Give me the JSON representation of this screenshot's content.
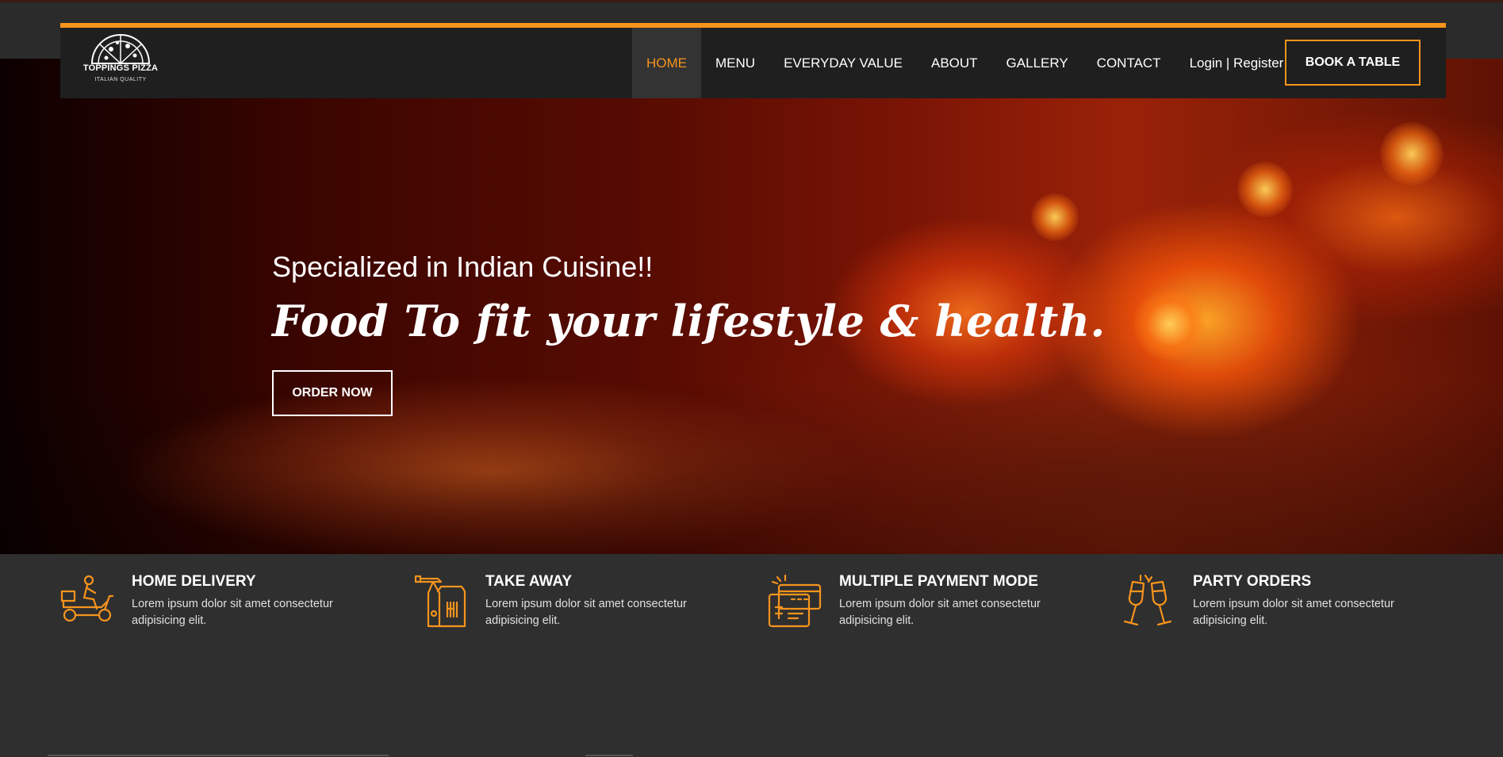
{
  "brand": {
    "name": "TOPPINGS PIZZA",
    "tagline": "ITALIAN QUALITY",
    "accent_color": "#f7941d"
  },
  "nav": {
    "items": [
      {
        "label": "HOME",
        "active": true
      },
      {
        "label": "MENU",
        "active": false
      },
      {
        "label": "EVERYDAY VALUE",
        "active": false
      },
      {
        "label": "ABOUT",
        "active": false
      },
      {
        "label": "GALLERY",
        "active": false
      },
      {
        "label": "CONTACT",
        "active": false
      }
    ],
    "login_label": "Login | Register",
    "book_label": "BOOK A TABLE"
  },
  "hero": {
    "subtitle": "Specialized in Indian Cuisine!!",
    "title": "Food To fit your lifestyle & health.",
    "cta_label": "ORDER NOW"
  },
  "features": [
    {
      "icon": "delivery-scooter-icon",
      "title": "HOME DELIVERY",
      "desc": "Lorem ipsum dolor sit amet consectetur adipisicing elit."
    },
    {
      "icon": "takeaway-bag-icon",
      "title": "TAKE AWAY",
      "desc": "Lorem ipsum dolor sit amet consectetur adipisicing elit."
    },
    {
      "icon": "payment-card-icon",
      "title": "MULTIPLE PAYMENT MODE",
      "desc": "Lorem ipsum dolor sit amet consectetur adipisicing elit."
    },
    {
      "icon": "party-glasses-icon",
      "title": "PARTY ORDERS",
      "desc": "Lorem ipsum dolor sit amet consectetur adipisicing elit."
    }
  ]
}
